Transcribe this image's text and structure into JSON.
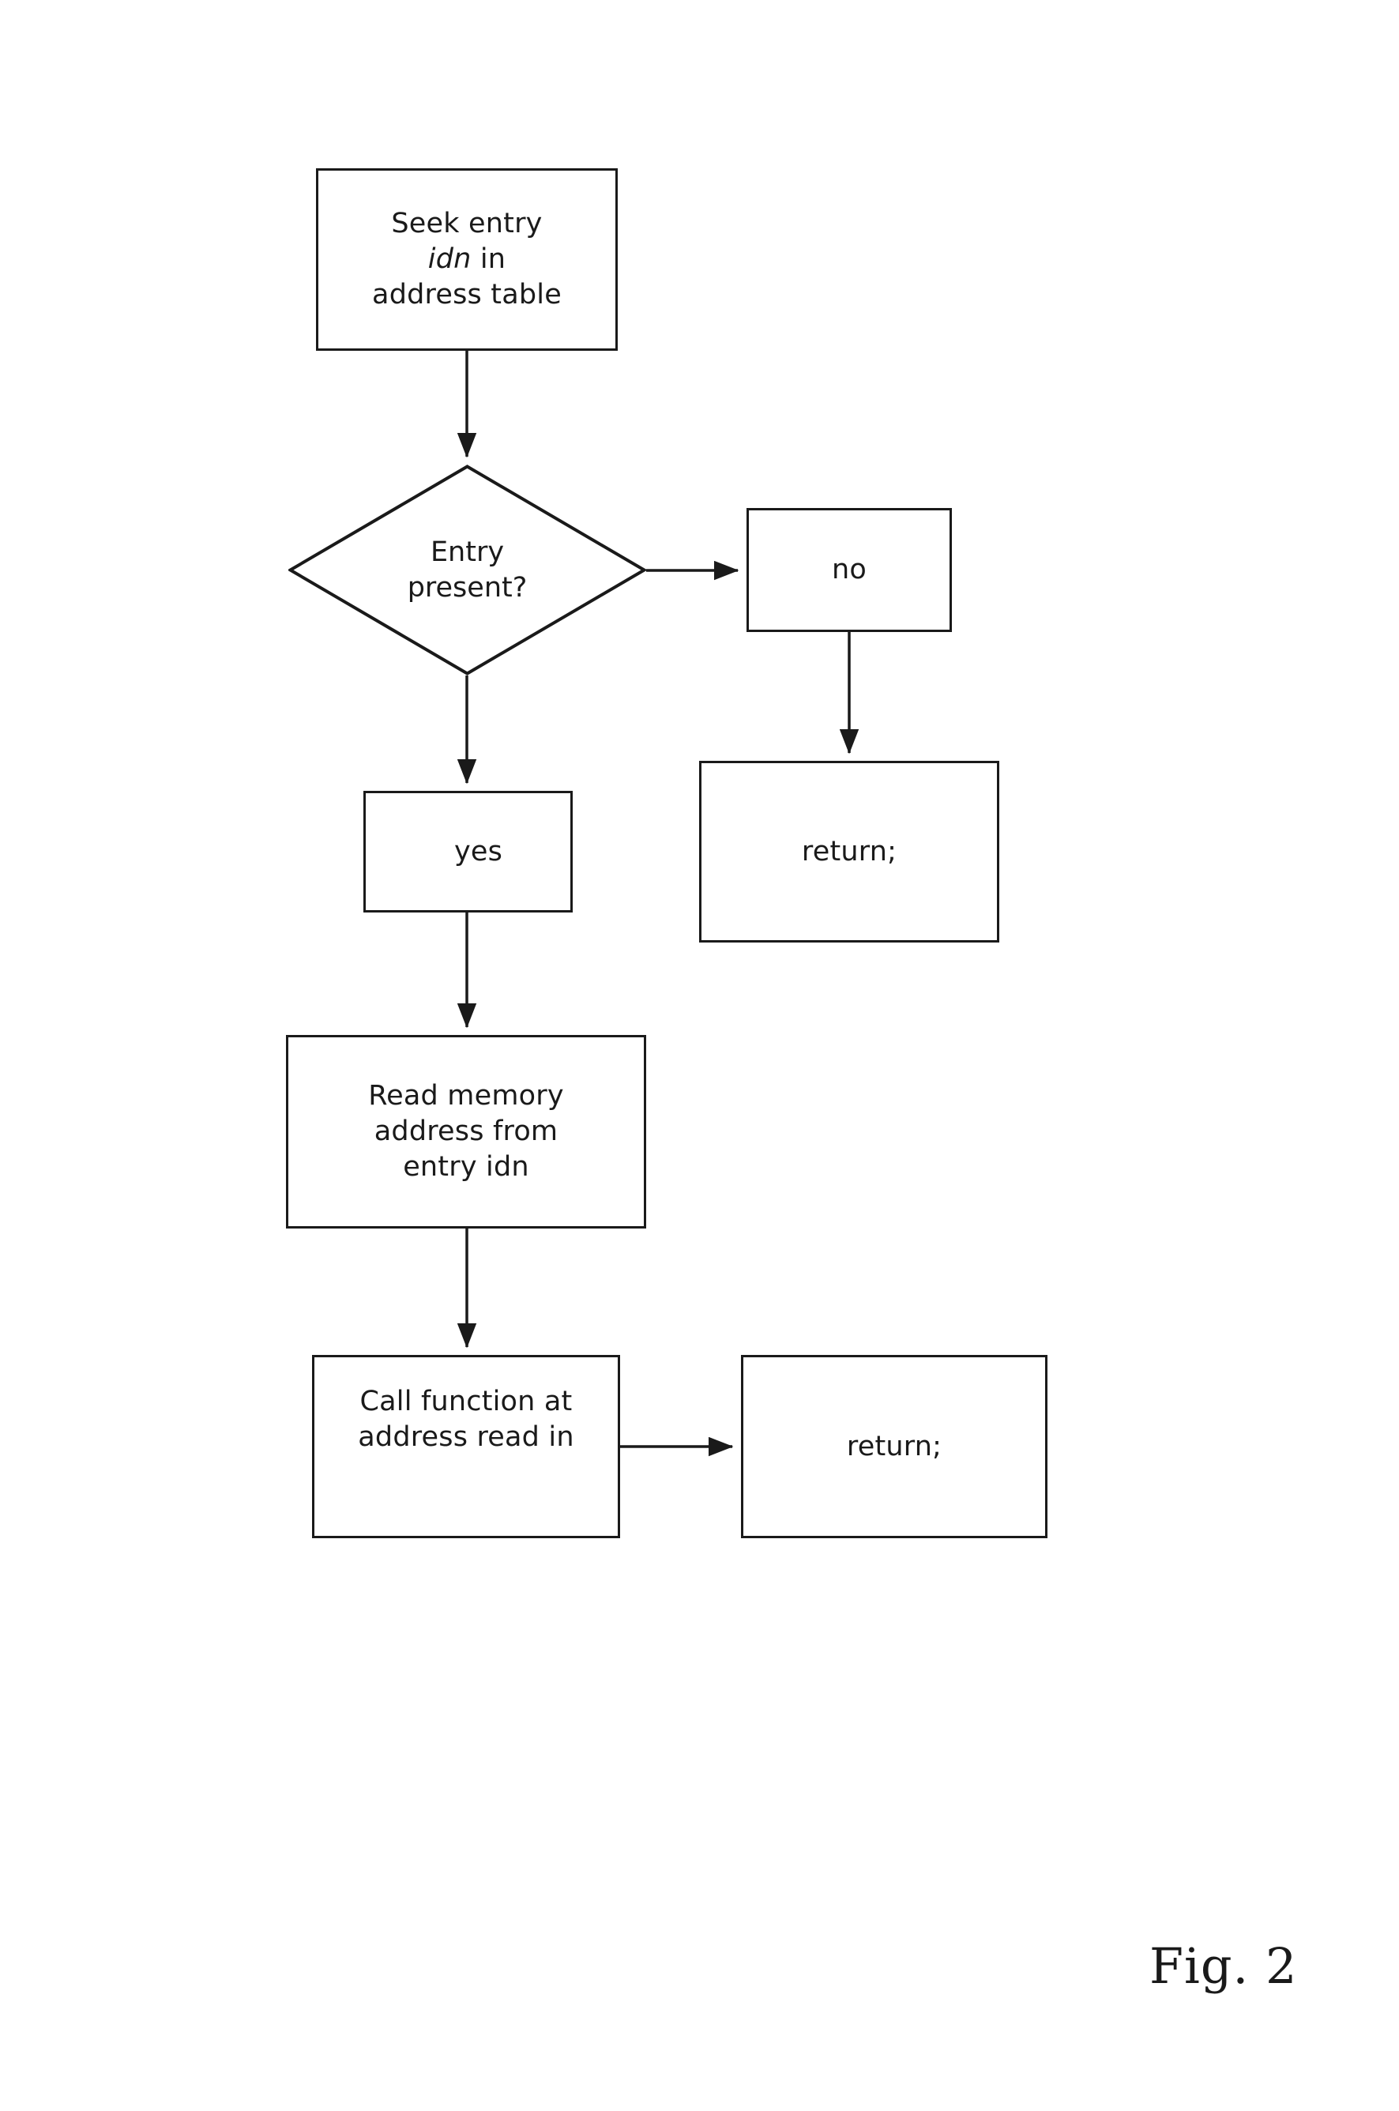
{
  "figure": {
    "caption": "Fig. 2",
    "background_color": "#ffffff",
    "stroke_color": "#1a1a1a"
  },
  "flowchart": {
    "nodes": [
      {
        "id": "seek",
        "shape": "process",
        "text_line1": "Seek entry",
        "text_line2_italic": "idn",
        "text_line2_rest": " in",
        "text_line3": "address table"
      },
      {
        "id": "decision",
        "shape": "decision",
        "text": "Entry\npresent?"
      },
      {
        "id": "no",
        "shape": "process",
        "text": "no"
      },
      {
        "id": "return-top",
        "shape": "process",
        "text": "return;"
      },
      {
        "id": "yes",
        "shape": "process",
        "text": "yes"
      },
      {
        "id": "read",
        "shape": "process",
        "text": "Read memory\naddress from\nentry idn"
      },
      {
        "id": "call",
        "shape": "process",
        "text": "Call function at\naddress read in"
      },
      {
        "id": "return-bottom",
        "shape": "process",
        "text": "return;"
      }
    ],
    "edges": [
      {
        "from": "seek",
        "to": "decision",
        "direction": "down",
        "label": ""
      },
      {
        "from": "decision",
        "to": "no",
        "direction": "right",
        "label": ""
      },
      {
        "from": "no",
        "to": "return-top",
        "direction": "down",
        "label": ""
      },
      {
        "from": "decision",
        "to": "yes",
        "direction": "down",
        "label": ""
      },
      {
        "from": "yes",
        "to": "read",
        "direction": "down",
        "label": ""
      },
      {
        "from": "read",
        "to": "call",
        "direction": "down",
        "label": ""
      },
      {
        "from": "call",
        "to": "return-bottom",
        "direction": "right",
        "label": ""
      }
    ]
  }
}
